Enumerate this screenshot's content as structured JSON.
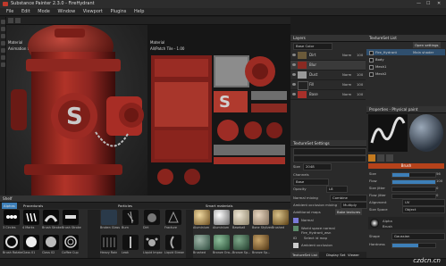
{
  "window": {
    "title": "Substance Painter 2.3.0 - FireHydrant",
    "minimize": "—",
    "maximize": "☐",
    "close": "✕"
  },
  "menu": [
    "File",
    "Edit",
    "Mode",
    "Window",
    "Viewport",
    "Plugins",
    "Help"
  ],
  "viewport3d": {
    "label": "Material",
    "sublabel": "Animation test"
  },
  "viewport2d": {
    "label": "Material",
    "sublabel": "All/Patch Tile - 1.00"
  },
  "layers": {
    "title": "Layers",
    "channel": "Base Color",
    "items": [
      {
        "name": "Dirt",
        "blend": "Norm",
        "opacity": "100",
        "thumb": "#6b5a3a"
      },
      {
        "name": "Blur",
        "blend": "",
        "opacity": "",
        "thumb": "#8a2a22"
      },
      {
        "name": "Dust",
        "blend": "Norm",
        "opacity": "100",
        "thumb": "#999999"
      },
      {
        "name": "Fill",
        "blend": "Norm",
        "opacity": "100",
        "thumb": "#222222"
      },
      {
        "name": "Base",
        "blend": "Norm",
        "opacity": "100",
        "thumb": "#a8302a"
      }
    ]
  },
  "texture_set_list": {
    "title": "TextureSet List",
    "settings_btn": "Open settings",
    "items": [
      {
        "name": "Fire_Hydrant",
        "shader": "Main shader"
      },
      {
        "name": "Body",
        "shader": ""
      },
      {
        "name": "Mesh1",
        "shader": ""
      },
      {
        "name": "Mesh2",
        "shader": ""
      }
    ]
  },
  "properties": {
    "title": "Properties - Physical paint",
    "brush_label": "Brush",
    "fields": [
      {
        "label": "Size",
        "value": "56"
      },
      {
        "label": "Flow",
        "value": "100"
      },
      {
        "label": "Size jitter",
        "value": "0"
      },
      {
        "label": "Flow jitter",
        "value": "0"
      },
      {
        "label": "Alignment",
        "value": "UV"
      },
      {
        "label": "Size Space",
        "value": "Object"
      }
    ],
    "alpha_label": "Alpha",
    "alpha_value": "Brush",
    "shape_label": "Shape",
    "shape_value": "Gaussian",
    "hardness_label": "Hardness"
  },
  "texture_set_settings": {
    "title": "TextureSet Settings",
    "fields": [
      {
        "label": "Size",
        "value": "2048"
      },
      {
        "label": "Channels",
        "value": "Base"
      },
      {
        "label": "Opacity",
        "value": "L8"
      },
      {
        "label": "Normal mixing",
        "value": "Combine"
      },
      {
        "label": "Ambient occlusion mixing",
        "value": "Multiply"
      },
      {
        "label": "Additional maps",
        "value": "Bake textures"
      }
    ],
    "maps": [
      {
        "name": "Normal",
        "value": "Normal"
      },
      {
        "name": "World space normal",
        "value": "Fire_Hydrant_wsn"
      },
      {
        "name": "ID",
        "value": "Select id map"
      },
      {
        "name": "Ambient occlusion",
        "value": "Fire_Hydrant_ao"
      }
    ]
  },
  "bottom_tabs": [
    "TextureSet List",
    "Display Set",
    "Viewer Set"
  ],
  "shelf": {
    "title": "Shelf",
    "filter_tabs": [
      "Alphas",
      "Procedurals",
      "Particles",
      "Smart materials"
    ],
    "categories": [
      "Alphas",
      "Grunges",
      "Procedurals",
      "Textures",
      "Hard Surfaces",
      "Filters",
      "Brushes",
      "Particles",
      "Tools",
      "Materials",
      "Smart materials",
      "Smart masks",
      "Environments"
    ],
    "alphas": [
      "3 Circles",
      "4 Marks",
      "Brush Stroke",
      "Brush Stroke",
      "Brush Rotate",
      "Brush Stroke",
      "Class 01",
      "Class 02",
      "Coffee Cup"
    ],
    "particles": [
      "Broken Glass",
      "Burn",
      "Dirt",
      "Fracture",
      "Heavy Rain",
      "Leak",
      "Liquid Impact",
      "Liquid Stream"
    ],
    "materials": [
      "Aluminium",
      "Aluminium",
      "Baseball",
      "Bone Stylized",
      "Brushed",
      "Brushed",
      "Bronze Ora...",
      "Bronze Sp...",
      "Bronze Sp..."
    ],
    "search": "Search"
  },
  "watermark": "czdcn.cn",
  "colors": {
    "accent": "#3d7fb8",
    "hydrant_red": "#a52a22",
    "panel": "#2a2a2a"
  }
}
